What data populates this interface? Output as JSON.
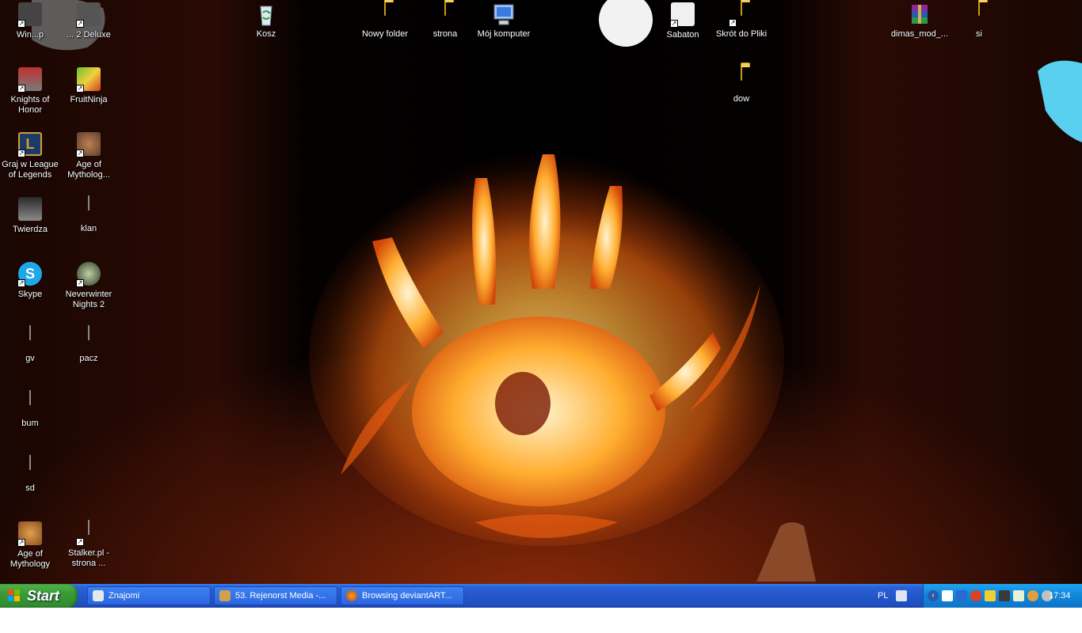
{
  "desktop": {
    "icons": [
      {
        "id": "win",
        "label": "Win...p",
        "type": "app",
        "shortcut": true
      },
      {
        "id": "deluxe",
        "label": "... 2 Deluxe",
        "type": "app",
        "shortcut": true
      },
      {
        "id": "kosz",
        "label": "Kosz",
        "type": "recycle"
      },
      {
        "id": "nowy-folder",
        "label": "Nowy folder",
        "type": "folder"
      },
      {
        "id": "strona",
        "label": "strona",
        "type": "folder"
      },
      {
        "id": "moj-komputer",
        "label": "Mój komputer",
        "type": "computer"
      },
      {
        "id": "sabaton",
        "label": "Sabaton",
        "type": "app",
        "shortcut": true
      },
      {
        "id": "skrot-do-pliki",
        "label": "Skrót do Pliki",
        "type": "folder",
        "shortcut": true
      },
      {
        "id": "dimas-mod",
        "label": "dimas_mod_...",
        "type": "archive"
      },
      {
        "id": "si",
        "label": "si",
        "type": "folder"
      },
      {
        "id": "dow",
        "label": "dow",
        "type": "folder"
      },
      {
        "id": "knights-of-honor",
        "label": "Knights of Honor",
        "type": "app",
        "shortcut": true
      },
      {
        "id": "fruitninja",
        "label": "FruitNinja",
        "type": "app",
        "shortcut": true
      },
      {
        "id": "league",
        "label": "Graj w League of Legends",
        "type": "app",
        "shortcut": true
      },
      {
        "id": "aom-mytholog",
        "label": "Age of Mytholog...",
        "type": "app",
        "shortcut": true
      },
      {
        "id": "twierdza",
        "label": "Twierdza",
        "type": "app"
      },
      {
        "id": "klan",
        "label": "klan",
        "type": "doc"
      },
      {
        "id": "skype",
        "label": "Skype",
        "type": "app",
        "shortcut": true
      },
      {
        "id": "nwn2",
        "label": "Neverwinter Nights 2",
        "type": "app",
        "shortcut": true
      },
      {
        "id": "gv",
        "label": "gv",
        "type": "doc"
      },
      {
        "id": "pacz",
        "label": "pacz",
        "type": "paint"
      },
      {
        "id": "bum",
        "label": "bum",
        "type": "doc"
      },
      {
        "id": "sd",
        "label": "sd",
        "type": "img"
      },
      {
        "id": "aom",
        "label": "Age of Mythology",
        "type": "app",
        "shortcut": true
      },
      {
        "id": "stalker",
        "label": "Stalker.pl - strona ...",
        "type": "firefox",
        "shortcut": true
      }
    ]
  },
  "taskbar": {
    "start_label": "Start",
    "tasks": [
      {
        "label": "Znajomi",
        "icon": "steam-icon"
      },
      {
        "label": "53. Rejenorst Media -...",
        "icon": "winamp-icon"
      },
      {
        "label": "Browsing deviantART...",
        "icon": "firefox-icon"
      }
    ],
    "language": "PL",
    "clock": "17:34"
  },
  "colors": {
    "taskbar": "#2457cc",
    "start": "#3a9a37",
    "tray": "#1185d8"
  }
}
